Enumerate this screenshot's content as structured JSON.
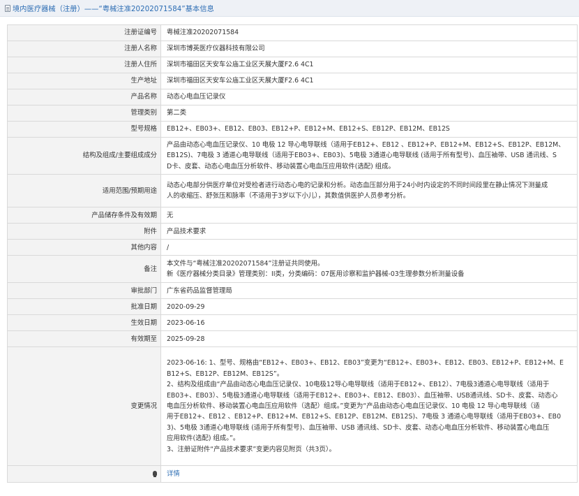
{
  "header": {
    "title": "境内医疗器械（注册）——“粤械注准20202071584”基本信息",
    "icon": "document-icon"
  },
  "rows": [
    {
      "label": "注册证编号",
      "value": "粤械注准20202071584"
    },
    {
      "label": "注册人名称",
      "value": "深圳市博英医疗仪器科技有限公司"
    },
    {
      "label": "注册人住所",
      "value": "深圳市福田区天安车公庙工业区天展大厦F2.6 4C1"
    },
    {
      "label": "生产地址",
      "value": "深圳市福田区天安车公庙工业区天展大厦F2.6 4C1"
    },
    {
      "label": "产品名称",
      "value": "动态心电血压记录仪"
    },
    {
      "label": "管理类别",
      "value": "第二类"
    },
    {
      "label": "型号规格",
      "value": "EB12+、EB03+、EB12、EB03、EB12+P、EB12+M、EB12+S、EB12P、EB12M、EB12S"
    },
    {
      "label": "结构及组成/主要组成成分",
      "lines": [
        "产品由动态心电血压记录仪、10 电极 12 导心电导联线（适用于EB12+、EB12 、EB12+P、EB12+M、EB12+S、EB12P、EB12M、",
        "EB12S)、7电极 3 通道心电导联线（适用于EB03+、EB03)、5电极 3通道心电导联线 (适用于所有型号)、血压袖带、USB 通讯线、S",
        "D卡、皮套、动态心电血压分析软件、移动装置心电血压应用软件(选配) 组成。"
      ]
    },
    {
      "label": "适用范围/预期用途",
      "lines": [
        "动态心电部分供医疗单位对受检者进行动态心电的记录和分析。动态血压部分用于24小时内设定的不同时间段里在静止情况下测量成",
        "人的收缩压、舒张压和脉率（不适用于3岁以下小儿），其数值供医护人员参考分析。"
      ]
    },
    {
      "label": "产品储存条件及有效期",
      "value": "无"
    },
    {
      "label": "附件",
      "value": "产品技术要求"
    },
    {
      "label": "其他内容",
      "value": "/"
    },
    {
      "label": "备注",
      "lines": [
        "本文件与“粤械注准20202071584”注册证共同使用。",
        "新《医疗器械分类目录》管理类别：II类，分类编码：07医用诊察和监护器械-03生理参数分析测量设备"
      ]
    },
    {
      "label": "审批部门",
      "value": "广东省药品监督管理局"
    },
    {
      "label": "批准日期",
      "value": "2020-09-29"
    },
    {
      "label": "生效日期",
      "value": "2023-06-16"
    },
    {
      "label": "有效期至",
      "value": "2025-09-28"
    },
    {
      "label": "变更情况",
      "lines": [
        "2023-06-16: 1、型号、规格由“EB12+、EB03+、EB12、EB03”变更为“EB12+、EB03+、EB12、EB03、EB12+P、EB12+M、E",
        "B12+S、EB12P、EB12M、EB12S”。",
        "2、结构及组成由“产品由动态心电血压记录仪、10电极12导心电导联线（适用于EB12+、EB12）、7电极3通道心电导联线（适用于",
        "EB03+、EB03）、5电极3通道心电导联线（适用于EB12+、EB03+、EB12、EB03）、血压袖带、USB通讯线、SD卡、皮套、动态心",
        "电血压分析软件、移动装置心电血压应用软件（选配）组成。”变更为“产品由动态心电血压记录仪、10 电极 12 导心电导联线（适",
        "用于EB12+、EB12 、EB12+P、EB12+M、EB12+S、EB12P、EB12M、EB12S)、7电极 3 通道心电导联线（适用于EB03+、EB0",
        "3)、5电极 3通道心电导联线 (适用于所有型号)、血压袖带、USB 通讯线、SD卡、皮套、动态心电血压分析软件、移动装置心电血压",
        "应用软件(选配) 组成。”。",
        "3、注册证附件“产品技术要求”变更内容见附页（共3页）。"
      ]
    }
  ],
  "footer": {
    "icon": "lightbulb-icon",
    "link_label": "详情"
  }
}
